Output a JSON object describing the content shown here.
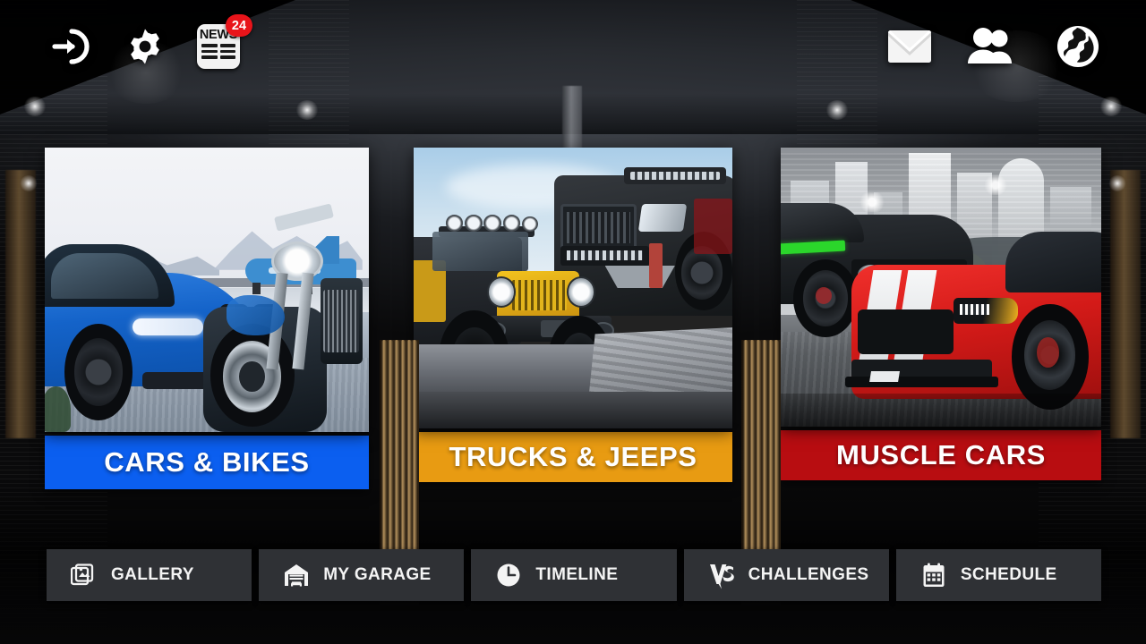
{
  "header": {
    "left_icons": [
      {
        "name": "login-icon",
        "label": "Login"
      },
      {
        "name": "settings-gear-icon",
        "label": "Settings"
      },
      {
        "name": "news-icon",
        "label": "NEWS",
        "badge": "24"
      }
    ],
    "right_icons": [
      {
        "name": "mail-icon",
        "label": "Messages"
      },
      {
        "name": "friends-icon",
        "label": "Friends"
      },
      {
        "name": "globe-icon",
        "label": "World"
      }
    ],
    "news_word": "NEWS",
    "news_badge_count": "24"
  },
  "categories": [
    {
      "id": "cars-bikes",
      "label": "CARS & BIKES",
      "color": "#0b5ff0",
      "image_alt": "Blue BMW M4 sports car and chrome motorcycle on an airfield with a jet"
    },
    {
      "id": "trucks-jeeps",
      "label": "TRUCKS & JEEPS",
      "color": "#e89b12",
      "image_alt": "Yellow and black Jeep Wrangler with light bar and lifted black Ford Raptor on rocks"
    },
    {
      "id": "muscle-cars",
      "label": "MUSCLE CARS",
      "color": "#b80d11",
      "image_alt": "Red Shelby Mustang with white stripes and black Dodge Challenger with green stripe in a city"
    }
  ],
  "bottom_nav": [
    {
      "id": "gallery",
      "label": "GALLERY",
      "icon": "photos-icon"
    },
    {
      "id": "my-garage",
      "label": "MY GARAGE",
      "icon": "garage-icon"
    },
    {
      "id": "timeline",
      "label": "TIMELINE",
      "icon": "clock-icon"
    },
    {
      "id": "challenges",
      "label": "CHALLENGES",
      "icon": "vs-icon"
    },
    {
      "id": "schedule",
      "label": "SCHEDULE",
      "icon": "calendar-icon"
    }
  ],
  "theme": {
    "badge_red": "#e8141a",
    "nav_button_bg": "#2f3135",
    "text_light": "#f4f4f4"
  }
}
